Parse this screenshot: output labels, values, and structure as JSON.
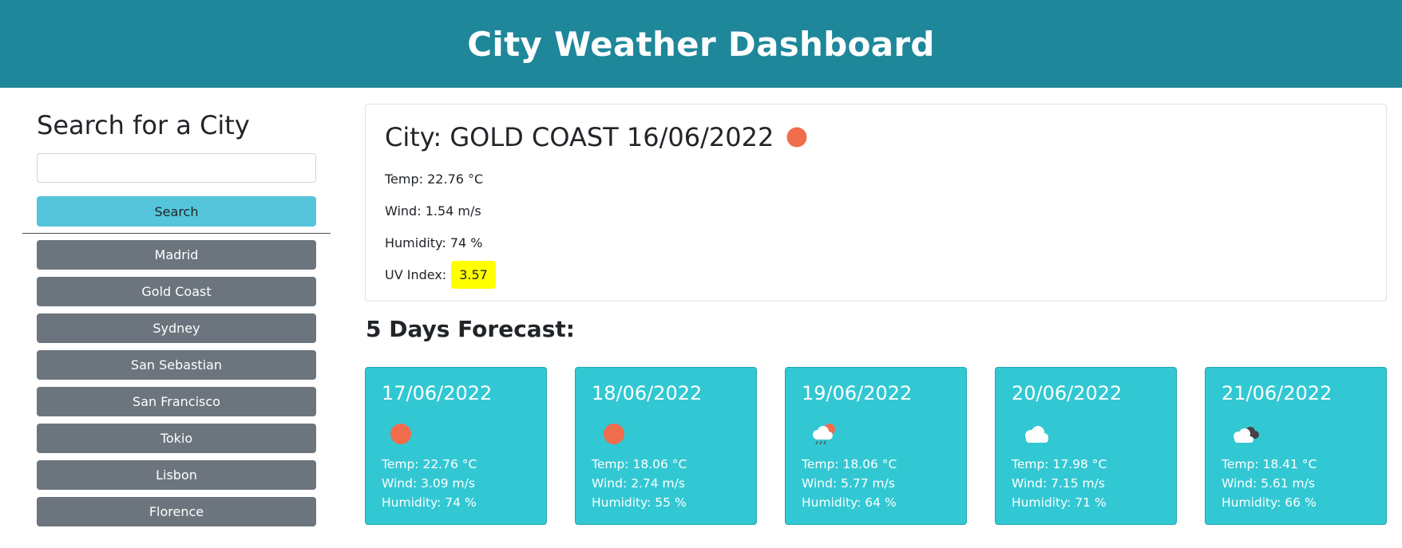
{
  "header": {
    "title": "City Weather Dashboard"
  },
  "sidebar": {
    "heading": "Search for a City",
    "search": {
      "value": "",
      "placeholder": ""
    },
    "search_label": "Search",
    "history": [
      "Madrid",
      "Gold Coast",
      "Sydney",
      "San Sebastian",
      "San Francisco",
      "Tokio",
      "Lisbon",
      "Florence"
    ]
  },
  "current": {
    "title": "City: GOLD COAST 16/06/2022",
    "icon": "sun-icon",
    "temp": "Temp: 22.76 °C",
    "wind": "Wind: 1.54 m/s",
    "humidity": "Humidity: 74 %",
    "uv_label": "UV Index:",
    "uv_value": "3.57",
    "uv_color": "#ffff00"
  },
  "forecast": {
    "title": "5 Days Forecast:",
    "days": [
      {
        "date": "17/06/2022",
        "icon": "sun-icon",
        "temp": "Temp: 22.76 °C",
        "wind": "Wind: 3.09 m/s",
        "humidity": "Humidity: 74 %"
      },
      {
        "date": "18/06/2022",
        "icon": "sun-icon",
        "temp": "Temp: 18.06 °C",
        "wind": "Wind: 2.74 m/s",
        "humidity": "Humidity: 55 %"
      },
      {
        "date": "19/06/2022",
        "icon": "rain-sun-icon",
        "temp": "Temp: 18.06 °C",
        "wind": "Wind: 5.77 m/s",
        "humidity": "Humidity: 64 %"
      },
      {
        "date": "20/06/2022",
        "icon": "cloud-icon",
        "temp": "Temp: 17.98 °C",
        "wind": "Wind: 7.15 m/s",
        "humidity": "Humidity: 71 %"
      },
      {
        "date": "21/06/2022",
        "icon": "broken-clouds-icon",
        "temp": "Temp: 18.41 °C",
        "wind": "Wind: 5.61 m/s",
        "humidity": "Humidity: 66 %"
      }
    ]
  },
  "colors": {
    "header": "#1f879a",
    "search_button": "#54c5da",
    "history_button": "#6c757d",
    "forecast_card": "#32c8d3",
    "sun": "#ef6c4d"
  }
}
